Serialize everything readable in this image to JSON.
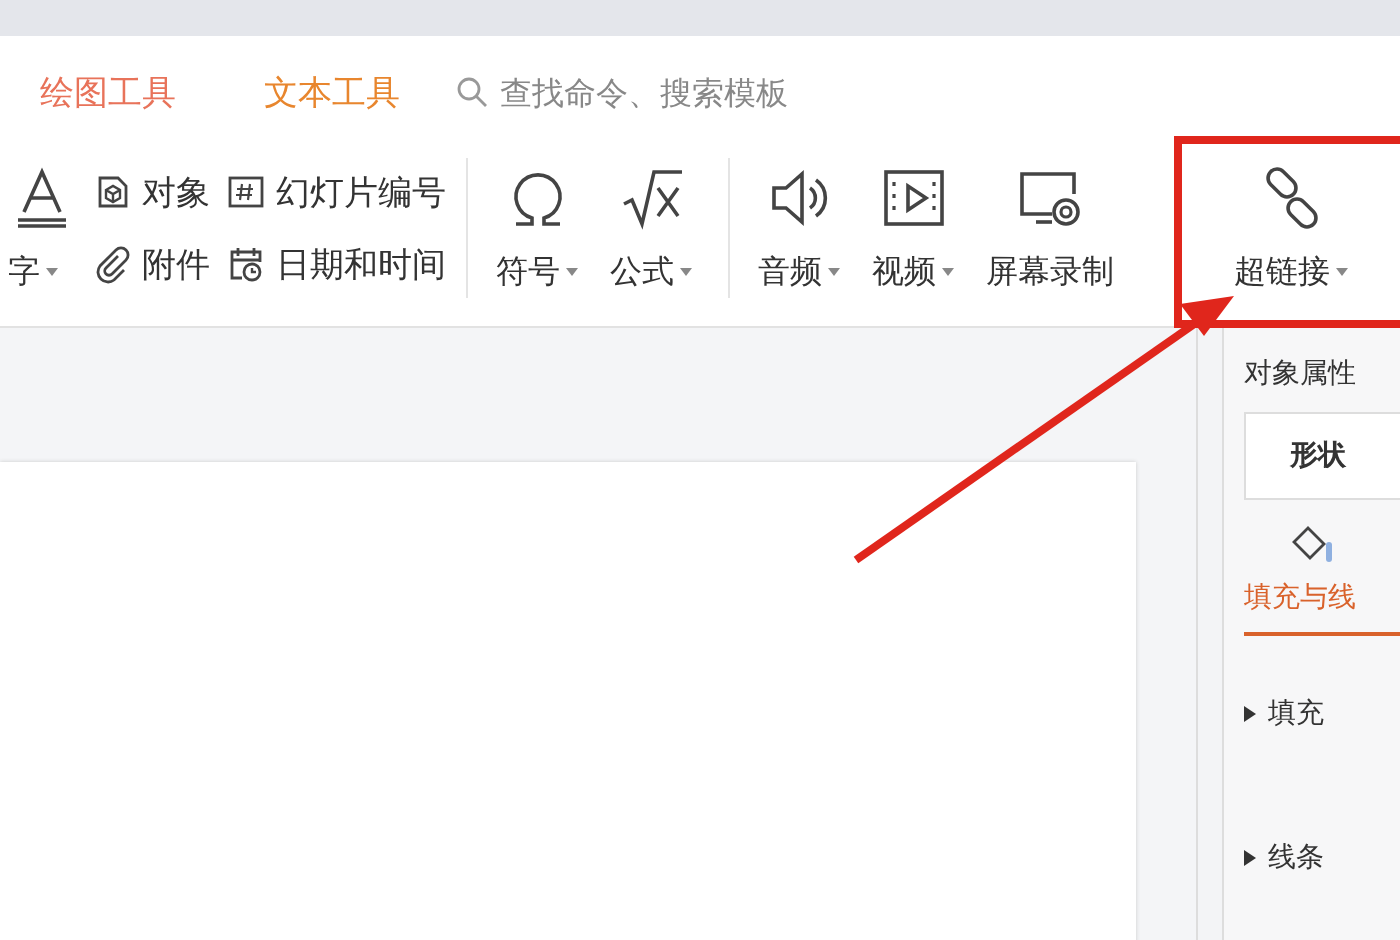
{
  "context_tabs": [
    {
      "label": "绘图工具",
      "color": "#e8735a"
    },
    {
      "label": "文本工具",
      "color": "#e8862e"
    }
  ],
  "search": {
    "placeholder": "查找命令、搜索模板"
  },
  "ribbon": {
    "art_text": {
      "label": "字",
      "dropdown": true
    },
    "small_items": [
      {
        "label": "对象",
        "kind": "object"
      },
      {
        "label": "附件",
        "kind": "attachment"
      },
      {
        "label": "幻灯片编号",
        "kind": "number"
      },
      {
        "label": "日期和时间",
        "kind": "date"
      }
    ],
    "groups": [
      [
        {
          "label": "符号",
          "kind": "symbol",
          "dropdown": true,
          "highlighted": false
        },
        {
          "label": "公式",
          "kind": "formula",
          "dropdown": true,
          "highlighted": false
        }
      ],
      [
        {
          "label": "音频",
          "kind": "audio",
          "dropdown": true,
          "highlighted": false
        },
        {
          "label": "视频",
          "kind": "video",
          "dropdown": true,
          "highlighted": false
        },
        {
          "label": "屏幕录制",
          "kind": "record",
          "dropdown": false,
          "highlighted": false
        },
        {
          "label": "超链接",
          "kind": "link",
          "dropdown": true,
          "highlighted": true
        }
      ]
    ]
  },
  "side_panel": {
    "title": "对象属性",
    "tabs": [
      {
        "label": "形状",
        "selected": true
      }
    ],
    "sub_tabs": [
      {
        "label": "填充与线",
        "selected": true
      }
    ],
    "sections": [
      {
        "label": "填充",
        "expanded": false
      },
      {
        "label": "线条",
        "expanded": false
      }
    ]
  }
}
